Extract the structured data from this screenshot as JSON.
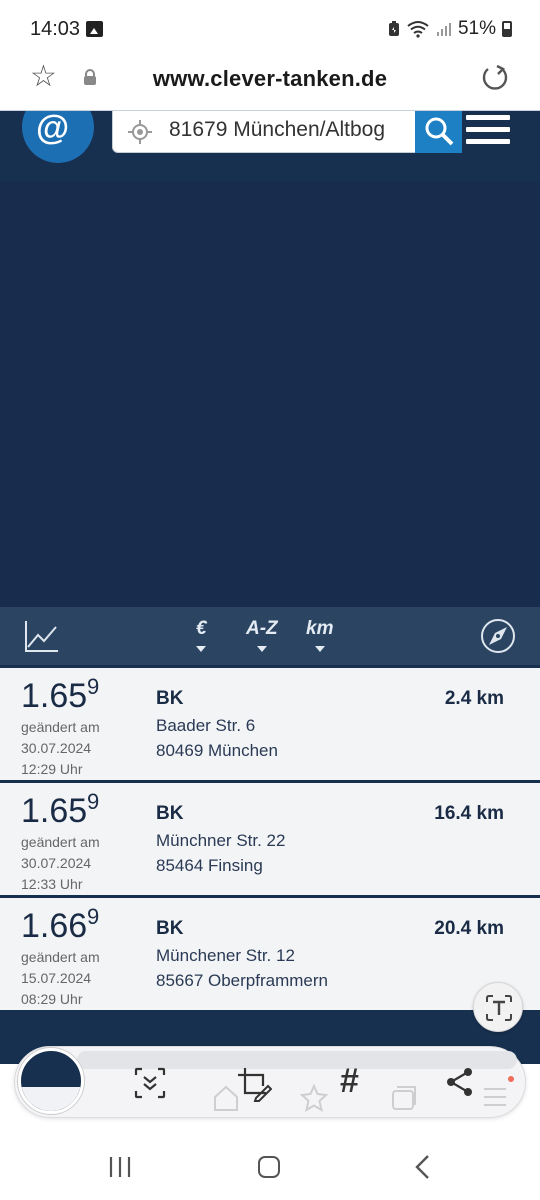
{
  "status_bar": {
    "time": "14:03",
    "battery": "51%",
    "icons": [
      "image-icon",
      "battery-saver-icon",
      "wifi-icon",
      "signal-icon",
      "battery-icon"
    ]
  },
  "browser": {
    "url": "www.clever-tanken.de",
    "icons": [
      "star-icon",
      "lock-icon",
      "reload-icon"
    ]
  },
  "header": {
    "search_value": "81679 München/Altbog",
    "icons": [
      "logo",
      "locate-icon",
      "search-icon",
      "menu-icon"
    ]
  },
  "toolbar": {
    "sort_price": "€",
    "sort_name": "A-Z",
    "sort_distance": "km",
    "icons": [
      "chart-icon",
      "compass-icon"
    ]
  },
  "stations": [
    {
      "price_main": "1.65",
      "price_sup": "9",
      "changed_label": "geändert am",
      "date": "30.07.2024",
      "time": "12:29 Uhr",
      "brand": "BK",
      "street": "Baader Str. 6",
      "city": "80469 München",
      "distance": "2.4 km"
    },
    {
      "price_main": "1.65",
      "price_sup": "9",
      "changed_label": "geändert am",
      "date": "30.07.2024",
      "time": "12:33 Uhr",
      "brand": "BK",
      "street": "Münchner Str. 22",
      "city": "85464 Finsing",
      "distance": "16.4 km"
    },
    {
      "price_main": "1.66",
      "price_sup": "9",
      "changed_label": "geändert am",
      "date": "15.07.2024",
      "time": "08:29 Uhr",
      "brand": "BK",
      "street": "Münchener Str. 12",
      "city": "85667 Oberpframmern",
      "distance": "20.4 km"
    }
  ],
  "capture_toolbar": {
    "hashtag": "#",
    "icons": [
      "scroll-capture-icon",
      "crop-edit-icon",
      "hashtag-icon",
      "share-icon",
      "text-extract-icon"
    ]
  },
  "colors": {
    "brand_dark": "#17304f",
    "toolbar": "#2a4462",
    "accent": "#1d7fc4"
  }
}
